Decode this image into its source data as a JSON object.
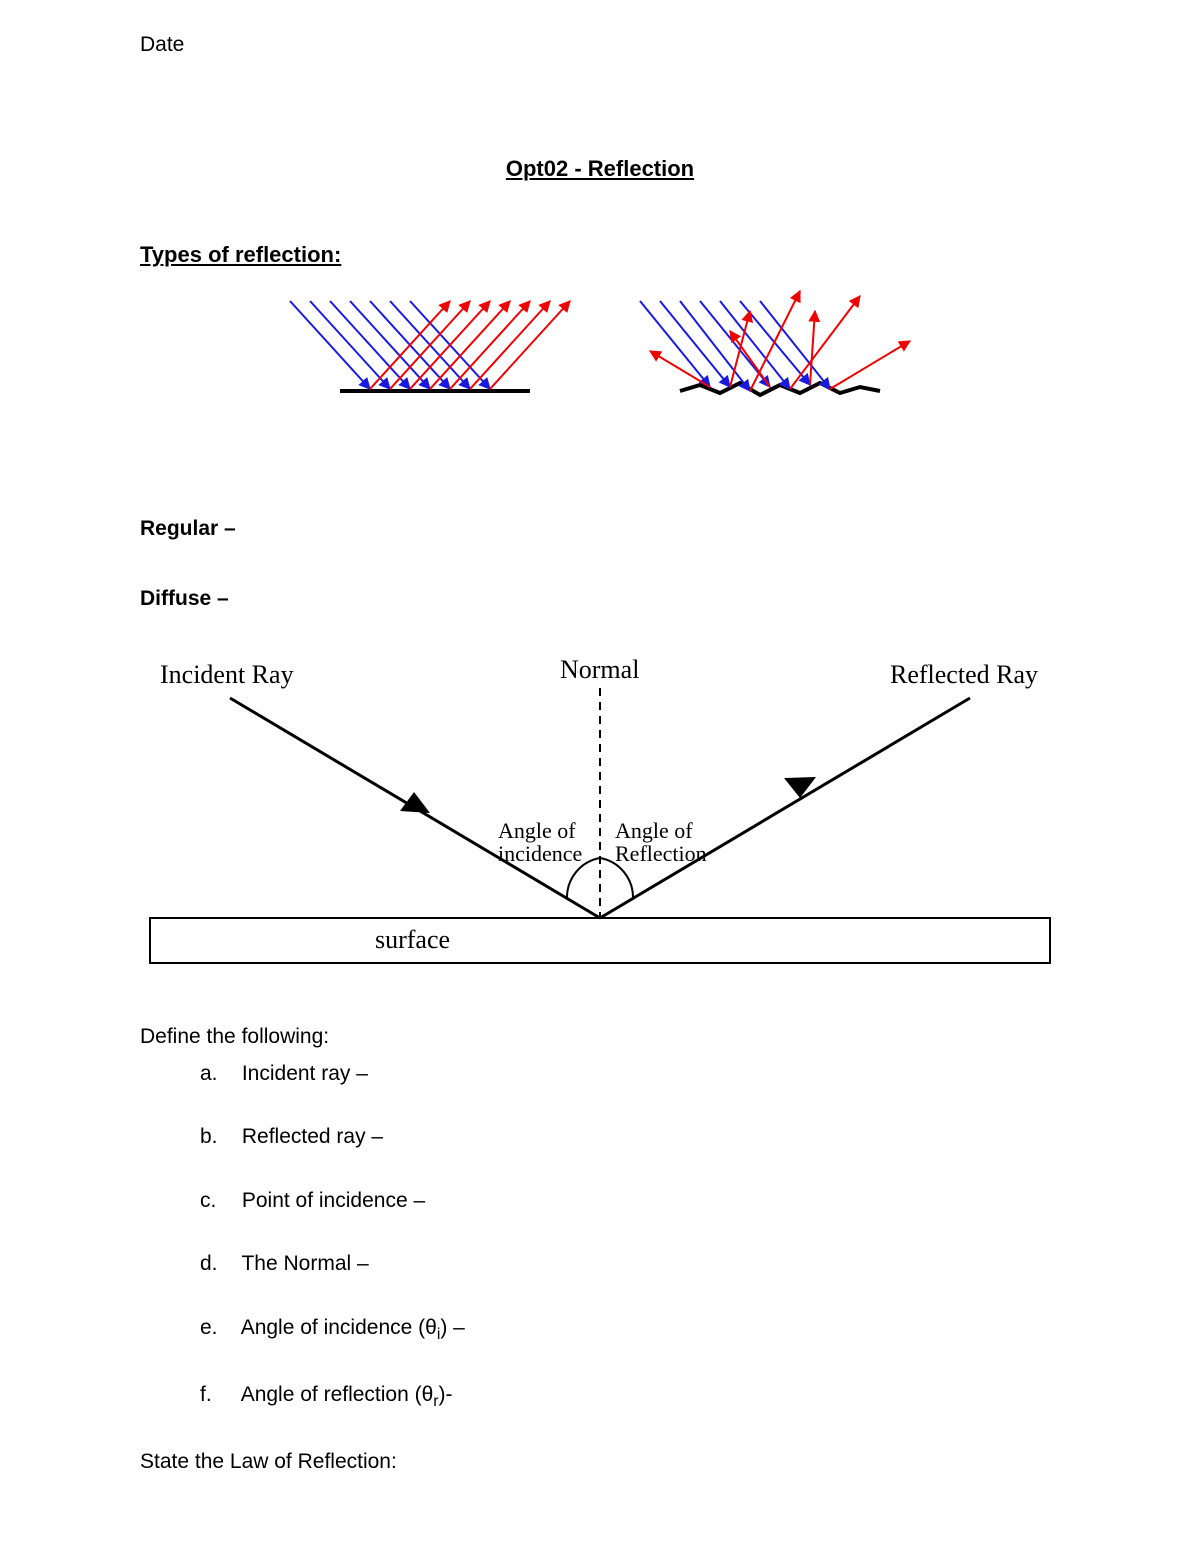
{
  "header": {
    "date_label": "Date"
  },
  "title": "Opt02 - Reflection",
  "section_types_heading": "Types of reflection:",
  "labels": {
    "regular": "Regular –",
    "diffuse": "Diffuse –"
  },
  "reflection_diagram": {
    "incident_ray": "Incident Ray",
    "normal": "Normal",
    "reflected_ray": "Reflected Ray",
    "angle_incidence": "Angle of",
    "angle_incidence2": "incidence",
    "angle_reflection": "Angle of",
    "angle_reflection2": "Reflection",
    "surface": "surface"
  },
  "define_heading": "Define the following:",
  "definitions": {
    "a": {
      "marker": "a.",
      "text": "Incident ray –"
    },
    "b": {
      "marker": "b.",
      "text": "Reflected ray –"
    },
    "c": {
      "marker": "c.",
      "text": "Point of incidence –"
    },
    "d": {
      "marker": "d.",
      "text": "The Normal –"
    },
    "e": {
      "marker": "e.",
      "text_pre": "Angle of incidence (θ",
      "sub": "i",
      "text_post": ") –"
    },
    "f": {
      "marker": "f.",
      "text_pre": "Angle of reflection (θ",
      "sub": "r",
      "text_post": ")-"
    }
  },
  "law_heading": "State the Law of Reflection:"
}
